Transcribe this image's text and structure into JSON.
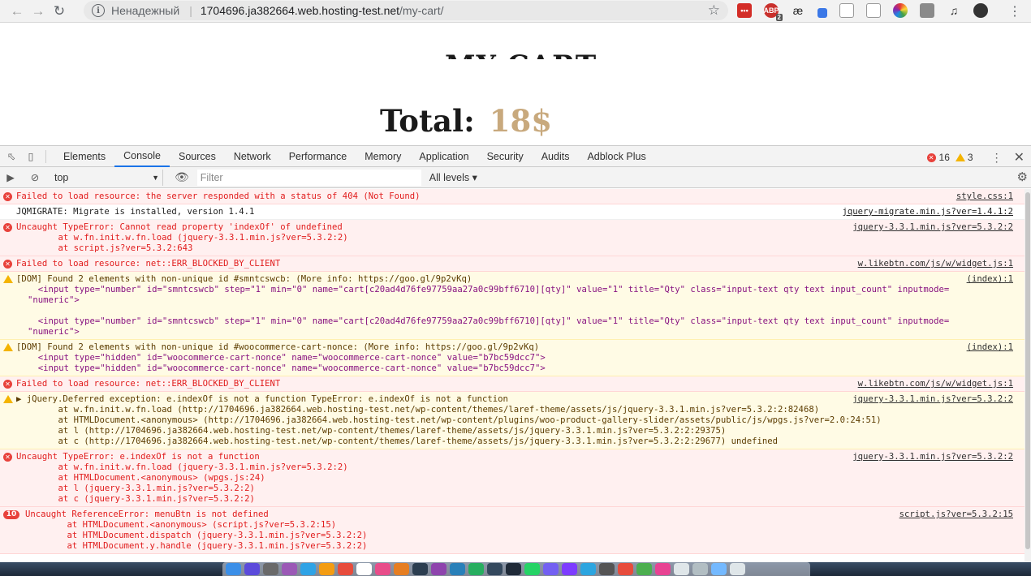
{
  "browser": {
    "insecure_label": "Ненадежный",
    "url_host": "1704696.ja382664.web.hosting-test.net",
    "url_path": "/my-cart/",
    "ext_badge": "2",
    "ext_ae": "æ"
  },
  "page": {
    "title": "MY CART",
    "total_label": "Total:",
    "total_value": "18$"
  },
  "devtools": {
    "tabs": [
      "Elements",
      "Console",
      "Sources",
      "Network",
      "Performance",
      "Memory",
      "Application",
      "Security",
      "Audits",
      "Adblock Plus"
    ],
    "active_tab": "Console",
    "error_count": "16",
    "warning_count": "3",
    "context": "top",
    "filter_placeholder": "Filter",
    "levels": "All levels ▾"
  },
  "messages": [
    {
      "type": "error",
      "source": "style.css:1",
      "lines": [
        "Failed to load resource: the server responded with a status of 404 (Not Found)"
      ]
    },
    {
      "type": "info",
      "source": "jquery-migrate.min.js?ver=1.4.1:2",
      "lines": [
        "JQMIGRATE: Migrate is installed, version 1.4.1"
      ]
    },
    {
      "type": "error",
      "source": "jquery-3.3.1.min.js?ver=5.3.2:2",
      "lines": [
        "Uncaught TypeError: Cannot read property 'indexOf' of undefined",
        "    at w.fn.init.w.fn.load (jquery-3.3.1.min.js?ver=5.3.2:2)",
        "    at script.js?ver=5.3.2:643"
      ]
    },
    {
      "type": "error",
      "source": "w.likebtn.com/js/w/widget.js:1",
      "lines": [
        "Failed to load resource: net::ERR_BLOCKED_BY_CLIENT"
      ]
    },
    {
      "type": "warn",
      "source": "(index):1",
      "lines": [
        "[DOM] Found 2 elements with non-unique id #smntcswcb: (More info: https://goo.gl/9p2vKq)",
        "  <input type=\"number\" id=\"smntcswcb\" step=\"1\" min=\"0\" name=\"cart[c20ad4d76fe97759aa27a0c99bff6710][qty]\" value=\"1\" title=\"Qty\" class=\"input-text qty text input_count\" inputmode=",
        "\"numeric\">",
        "",
        "  <input type=\"number\" id=\"smntcswcb\" step=\"1\" min=\"0\" name=\"cart[c20ad4d76fe97759aa27a0c99bff6710][qty]\" value=\"1\" title=\"Qty\" class=\"input-text qty text input_count\" inputmode=",
        "\"numeric\">"
      ]
    },
    {
      "type": "warn",
      "source": "(index):1",
      "lines": [
        "[DOM] Found 2 elements with non-unique id #woocommerce-cart-nonce: (More info: https://goo.gl/9p2vKq)",
        "  <input type=\"hidden\" id=\"woocommerce-cart-nonce\" name=\"woocommerce-cart-nonce\" value=\"b7bc59dcc7\">",
        "  <input type=\"hidden\" id=\"woocommerce-cart-nonce\" name=\"woocommerce-cart-nonce\" value=\"b7bc59dcc7\">"
      ]
    },
    {
      "type": "error",
      "source": "w.likebtn.com/js/w/widget.js:1",
      "lines": [
        "Failed to load resource: net::ERR_BLOCKED_BY_CLIENT"
      ]
    },
    {
      "type": "warn",
      "source": "jquery-3.3.1.min.js?ver=5.3.2:2",
      "lines": [
        "▶ jQuery.Deferred exception: e.indexOf is not a function TypeError: e.indexOf is not a function",
        "    at w.fn.init.w.fn.load (http://1704696.ja382664.web.hosting-test.net/wp-content/themes/laref-theme/assets/js/jquery-3.3.1.min.js?ver=5.3.2:2:82468)",
        "    at HTMLDocument.<anonymous> (http://1704696.ja382664.web.hosting-test.net/wp-content/plugins/woo-product-gallery-slider/assets/public/js/wpgs.js?ver=2.0:24:51)",
        "    at l (http://1704696.ja382664.web.hosting-test.net/wp-content/themes/laref-theme/assets/js/jquery-3.3.1.min.js?ver=5.3.2:2:29375)",
        "    at c (http://1704696.ja382664.web.hosting-test.net/wp-content/themes/laref-theme/assets/js/jquery-3.3.1.min.js?ver=5.3.2:2:29677) undefined"
      ]
    },
    {
      "type": "error",
      "source": "jquery-3.3.1.min.js?ver=5.3.2:2",
      "lines": [
        "Uncaught TypeError: e.indexOf is not a function",
        "    at w.fn.init.w.fn.load (jquery-3.3.1.min.js?ver=5.3.2:2)",
        "    at HTMLDocument.<anonymous> (wpgs.js:24)",
        "    at l (jquery-3.3.1.min.js?ver=5.3.2:2)",
        "    at c (jquery-3.3.1.min.js?ver=5.3.2:2)"
      ]
    },
    {
      "type": "error",
      "count": "10",
      "source": "script.js?ver=5.3.2:15",
      "lines": [
        "Uncaught ReferenceError: menuBtn is not defined",
        "    at HTMLDocument.<anonymous> (script.js?ver=5.3.2:15)",
        "    at HTMLDocument.dispatch (jquery-3.3.1.min.js?ver=5.3.2:2)",
        "    at HTMLDocument.y.handle (jquery-3.3.1.min.js?ver=5.3.2:2)"
      ]
    }
  ],
  "colors": {
    "error_bg": "#fff0f0",
    "error_text": "#e11c1c",
    "warn_bg": "#fffbe5",
    "accent_tab": "#1a73e8",
    "total_value": "#c8a97d"
  }
}
